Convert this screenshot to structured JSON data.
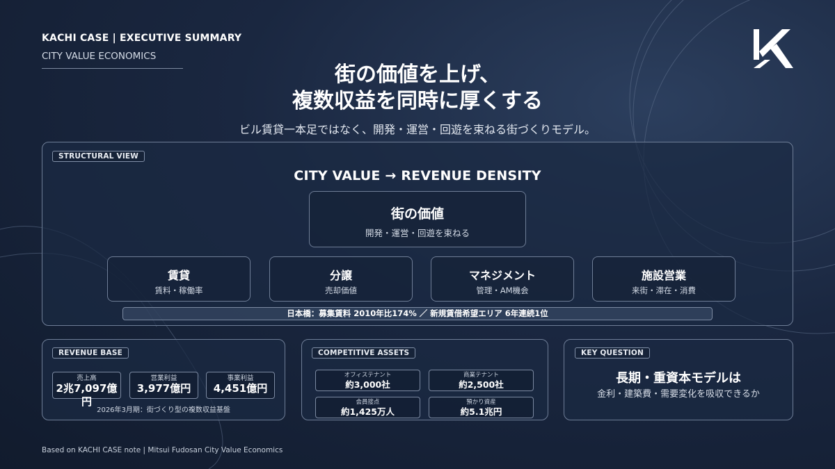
{
  "header": {
    "brand": "KACHI CASE | EXECUTIVE SUMMARY",
    "subtitle": "CITY VALUE ECONOMICS",
    "logo_icon": "kachi-k-logo"
  },
  "headline": {
    "line1": "街の価値を上げ、",
    "line2": "複数収益を同時に厚くする",
    "subline": "ビル賃貸一本足ではなく、開発・運営・回遊を束ねる街づくりモデル。"
  },
  "structural_view": {
    "tag": "STRUCTURAL VIEW",
    "title": "CITY VALUE  →  REVENUE DENSITY",
    "center": {
      "title": "街の価値",
      "subtitle": "開発・運営・回遊を束ねる"
    },
    "revenues": [
      {
        "title": "賃貸",
        "subtitle": "賃料・稼働率"
      },
      {
        "title": "分譲",
        "subtitle": "売却価値"
      },
      {
        "title": "マネジメント",
        "subtitle": "管理・AM機会"
      },
      {
        "title": "施設営業",
        "subtitle": "来街・滞在・消費"
      }
    ],
    "stat": "日本橋：募集賃料 2010年比174% ／ 新規賃借希望エリア 6年連続1位"
  },
  "revenue_base": {
    "tag": "REVENUE BASE",
    "metrics": [
      {
        "label": "売上高",
        "value": "2兆7,097億円"
      },
      {
        "label": "営業利益",
        "value": "3,977億円"
      },
      {
        "label": "事業利益",
        "value": "4,451億円"
      }
    ],
    "note": "2026年3月期：街づくり型の複数収益基盤"
  },
  "competitive_assets": {
    "tag": "COMPETITIVE ASSETS",
    "items": [
      {
        "label": "オフィステナント",
        "value": "約3,000社"
      },
      {
        "label": "商業テナント",
        "value": "約2,500社"
      },
      {
        "label": "会員接点",
        "value": "約1,425万人"
      },
      {
        "label": "預かり資産",
        "value": "約5.1兆円"
      }
    ]
  },
  "key_question": {
    "tag": "KEY QUESTION",
    "title": "長期・重資本モデルは",
    "subtitle": "金利・建築費・需要変化を吸収できるか"
  },
  "footer": {
    "source": "Based on KACHI CASE note | Mitsui Fudosan City Value Economics"
  },
  "colors": {
    "background": "#162238",
    "panel_border": "#6f7e97",
    "text": "#ffffff"
  }
}
